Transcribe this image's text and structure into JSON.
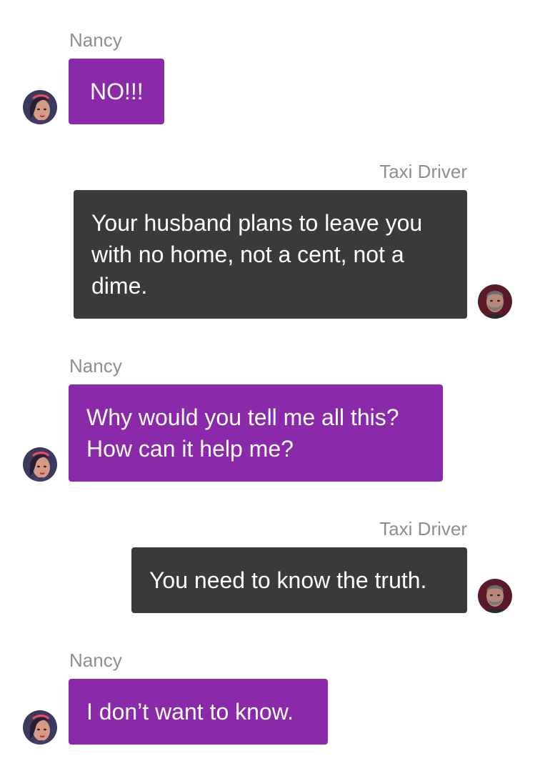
{
  "messages": [
    {
      "side": "left",
      "sender": "Nancy",
      "text": "NO!!!",
      "avatar": "nancy-avatar"
    },
    {
      "side": "right",
      "sender": "Taxi Driver",
      "text": "Your husband plans to leave you with no home, not a cent, not a dime.",
      "avatar": "taxi-driver-avatar"
    },
    {
      "side": "left",
      "sender": "Nancy",
      "text": "Why would you tell me all this? How can it help me?",
      "avatar": "nancy-avatar"
    },
    {
      "side": "right",
      "sender": "Taxi Driver",
      "text": "You need to know the truth.",
      "avatar": "taxi-driver-avatar"
    },
    {
      "side": "left",
      "sender": "Nancy",
      "text": "I don’t want to know.",
      "avatar": "nancy-avatar"
    }
  ],
  "colors": {
    "nancy_bubble": "#8a2aaa",
    "driver_bubble": "#3a3a3a",
    "sender_label": "#8e8e8e",
    "bubble_text": "#ffffff",
    "background": "#ffffff"
  }
}
